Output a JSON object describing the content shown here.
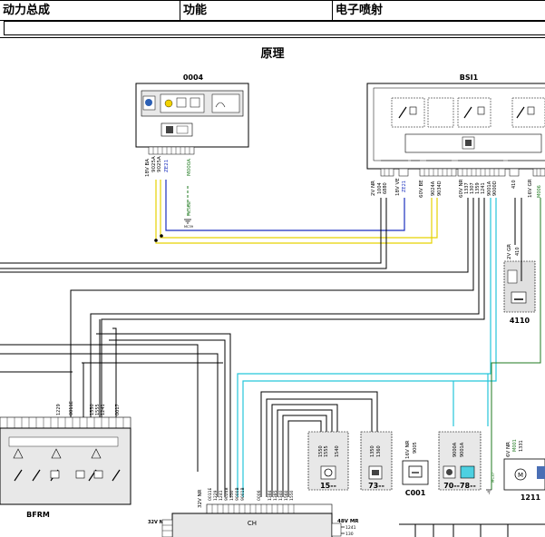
{
  "header": {
    "col1": "动力总成",
    "col2": "功能",
    "col3": "电子喷射"
  },
  "section_title": "原理",
  "components": {
    "c0004": {
      "name": "0004",
      "wires": [
        "18V BA",
        "9025A",
        "9025A",
        "ZE21",
        "M000A"
      ],
      "ground": "MC39 MC36"
    },
    "bsi1": {
      "name": "BSI1",
      "left_conn": [
        "2V NR",
        "1004",
        "6880"
      ],
      "mid_conn": [
        "18V VE",
        "ZE21"
      ],
      "conn2": [
        "60V BE",
        "9024A",
        "9034D"
      ],
      "conn3": [
        "60V NR",
        "1337",
        "1307",
        "1359",
        "1241",
        "9001A",
        "9000D"
      ],
      "right_pin": "410",
      "right_conn": [
        "16V GR",
        "M006"
      ]
    },
    "c4110": {
      "name": "4110",
      "conn": "2V GR",
      "pin": "410"
    },
    "bfrm": {
      "name": "BFRM",
      "pins": [
        "1229",
        "0011E",
        "1550",
        "1555",
        "1241",
        "0017"
      ]
    },
    "c15": {
      "name": "15--",
      "pins": [
        "1550",
        "1555",
        "1540"
      ]
    },
    "c73": {
      "name": "73--",
      "pins": [
        "1350",
        "1360"
      ]
    },
    "c001": {
      "name": "C001",
      "conn": "16V NR",
      "pin": "9005"
    },
    "c70": {
      "name": "70--78--",
      "pins": [
        "9000A",
        "9001A"
      ]
    },
    "c1211": {
      "name": "1211",
      "conn": "6V NR",
      "pins": [
        "M001",
        "1331"
      ],
      "ground": "MC37"
    },
    "ch": {
      "name": "CH",
      "conn_left": "32V NR",
      "conn_right": "48V MR",
      "right_pins": [
        "1241",
        "130"
      ],
      "top_pins": [
        "0011E",
        "1229",
        "1241",
        "9024B",
        "1550",
        "9000B",
        "9001B",
        "0006",
        "1384",
        "1385",
        "1340",
        "1560",
        "1550"
      ]
    }
  }
}
